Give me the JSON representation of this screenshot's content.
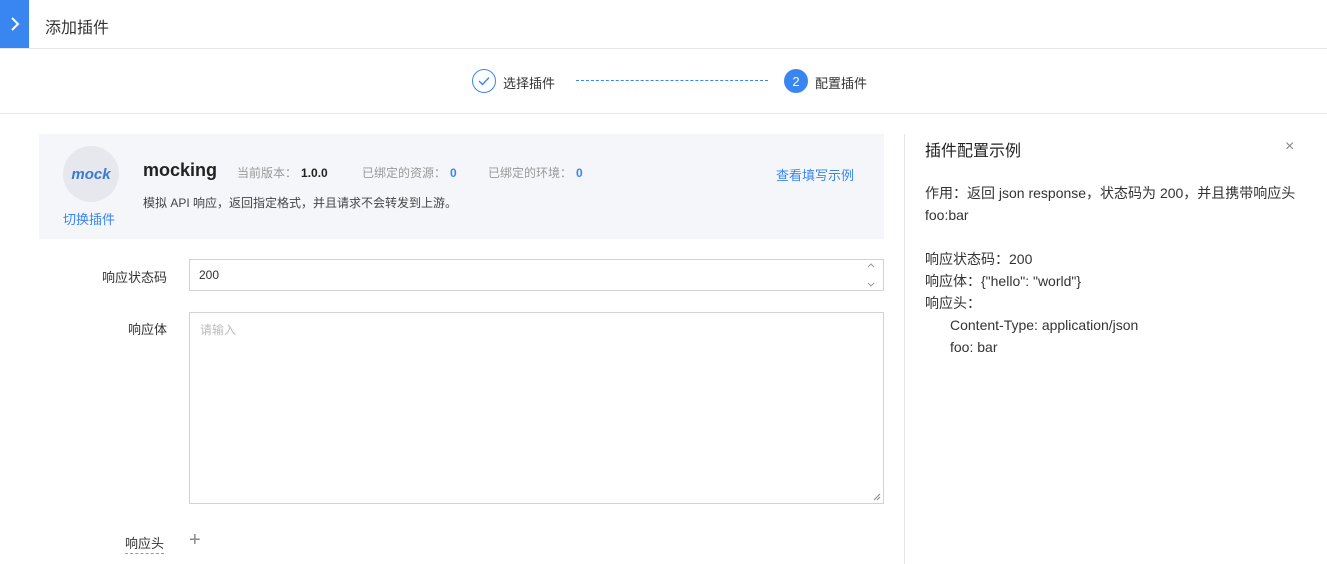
{
  "header": {
    "title": "添加插件"
  },
  "steps": [
    {
      "label": "选择插件",
      "status": "done"
    },
    {
      "number": "2",
      "label": "配置插件",
      "status": "active"
    }
  ],
  "plugin": {
    "avatar_text": "mock",
    "switch_label": "切换插件",
    "name": "mocking",
    "version_label": "当前版本：",
    "version": "1.0.0",
    "resources_label": "已绑定的资源：",
    "resources_count": "0",
    "envs_label": "已绑定的环境：",
    "envs_count": "0",
    "description": "模拟 API 响应，返回指定格式，并且请求不会转发到上游。",
    "example_link": "查看填写示例"
  },
  "form": {
    "status_code_label": "响应状态码",
    "status_code_value": "200",
    "body_label": "响应体",
    "body_placeholder": "请输入",
    "headers_label": "响应头",
    "add_symbol": "+"
  },
  "side_panel": {
    "title": "插件配置示例",
    "close_symbol": "×",
    "purpose_line1": "作用：返回 json response，状态码为 200，并且携带响应头",
    "purpose_line2": "foo:bar",
    "status_line": "响应状态码：200",
    "body_line": "响应体：{\"hello\": \"world\"}",
    "headers_line": "响应头：",
    "header_item1": "Content-Type: application/json",
    "header_item2": "foo: bar"
  },
  "colors": {
    "accent": "#3a86f0",
    "card_bg": "#f4f6fa"
  }
}
